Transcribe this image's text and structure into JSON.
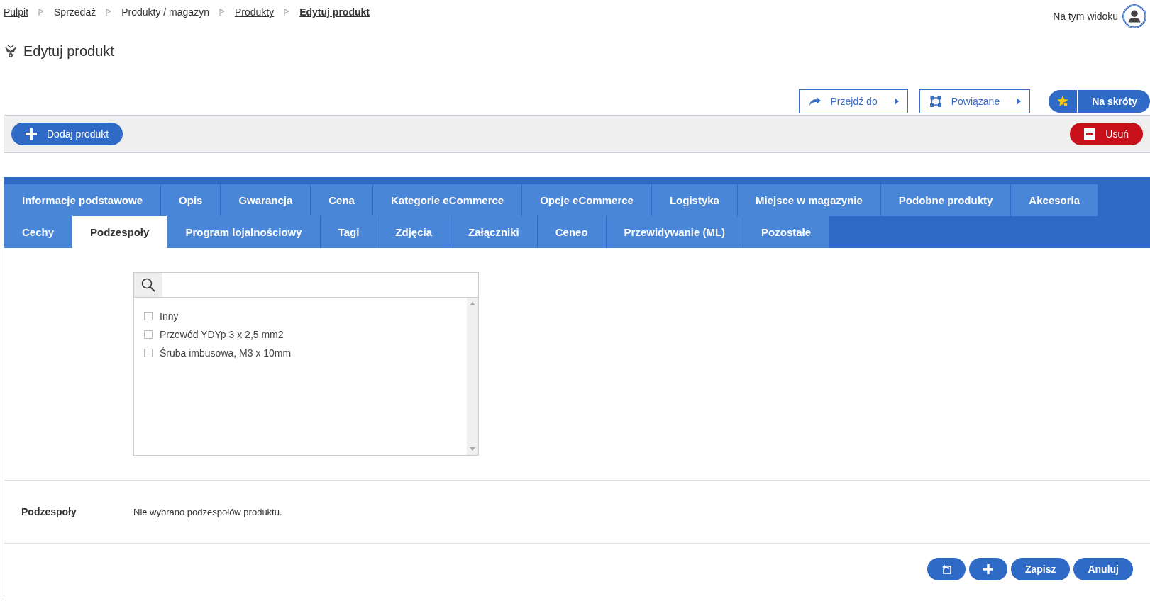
{
  "breadcrumbs": [
    {
      "label": "Pulpit",
      "kind": "link"
    },
    {
      "label": "Sprzedaż",
      "kind": "plain"
    },
    {
      "label": "Produkty / magazyn",
      "kind": "plain"
    },
    {
      "label": "Produkty",
      "kind": "link"
    },
    {
      "label": "Edytuj produkt",
      "kind": "current"
    }
  ],
  "view_menu": {
    "label": "Na tym widoku"
  },
  "page_title": "Edytuj produkt",
  "actions": [
    {
      "label": "Przejdź do",
      "kind": "goto"
    },
    {
      "label": "Powiązane",
      "kind": "related"
    },
    {
      "label": "Na skróty",
      "kind": "shortcuts"
    }
  ],
  "toolbar": {
    "add_button": "Dodaj produkt",
    "delete_button": "Usuń"
  },
  "tabs": [
    [
      {
        "label": "Informacje podstawowe",
        "selected": false
      },
      {
        "label": "Opis",
        "selected": false
      },
      {
        "label": "Gwarancja",
        "selected": false
      },
      {
        "label": "Cena",
        "selected": false
      },
      {
        "label": "Kategorie eCommerce",
        "selected": false
      },
      {
        "label": "Opcje eCommerce",
        "selected": false
      },
      {
        "label": "Logistyka",
        "selected": false
      },
      {
        "label": "Miejsce w magazynie",
        "selected": false
      },
      {
        "label": "Podobne produkty",
        "selected": false
      },
      {
        "label": "Akcesoria",
        "selected": false
      }
    ],
    [
      {
        "label": "Cechy",
        "selected": false
      },
      {
        "label": "Podzespoły",
        "selected": true
      },
      {
        "label": "Program lojalnościowy",
        "selected": false
      },
      {
        "label": "Tagi",
        "selected": false
      },
      {
        "label": "Zdjęcia",
        "selected": false
      },
      {
        "label": "Załączniki",
        "selected": false
      },
      {
        "label": "Ceneo",
        "selected": false
      },
      {
        "label": "Przewidywanie (ML)",
        "selected": false
      },
      {
        "label": "Pozostałe",
        "selected": false
      }
    ]
  ],
  "components_list": {
    "items": [
      {
        "label": "Inny",
        "checked": false
      },
      {
        "label": "Przewód YDYp 3 x 2,5 mm2",
        "checked": false
      },
      {
        "label": "Śruba imbusowa, M3 x 10mm",
        "checked": false
      }
    ]
  },
  "summary": {
    "label": "Podzespoły",
    "value": "Nie wybrano podzespołów produktu."
  },
  "footer_buttons": [
    {
      "kind": "back"
    },
    {
      "kind": "add"
    },
    {
      "kind": "text",
      "label": "Zapisz"
    },
    {
      "kind": "text",
      "label": "Anuluj"
    }
  ]
}
